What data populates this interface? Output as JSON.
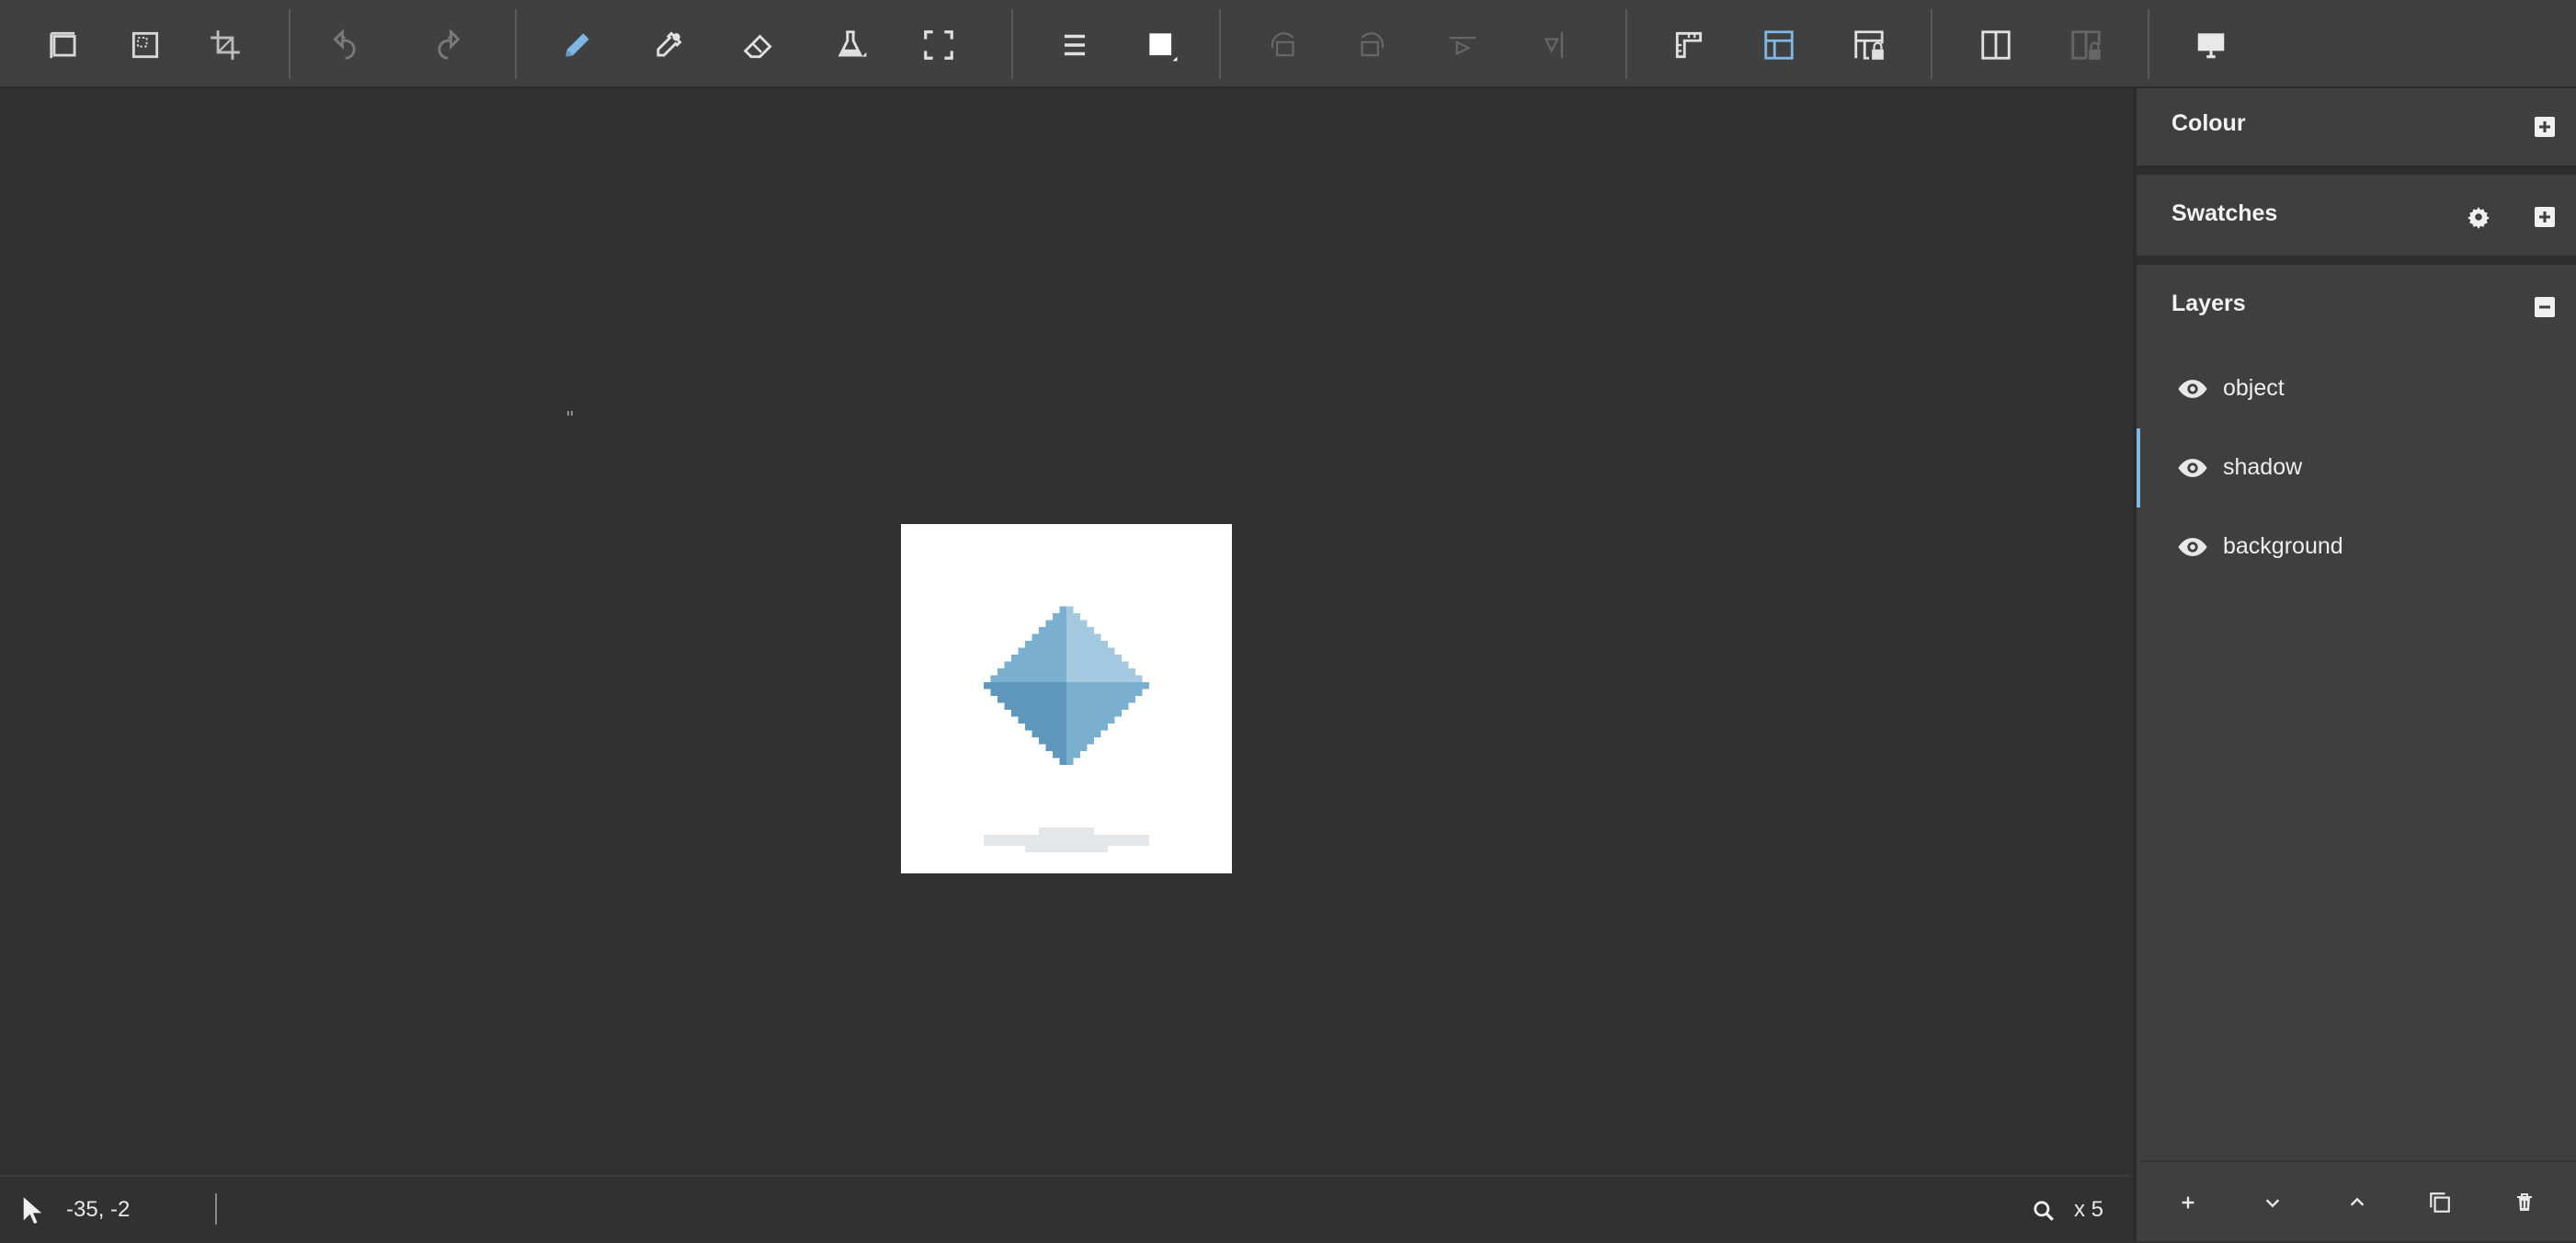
{
  "toolbar": {
    "tools": [
      {
        "name": "canvas-size-icon"
      },
      {
        "name": "marquee-select-icon"
      },
      {
        "name": "crop-icon"
      },
      {
        "name": "undo-icon"
      },
      {
        "name": "redo-icon"
      },
      {
        "name": "pencil-icon",
        "active": true
      },
      {
        "name": "eyedropper-icon"
      },
      {
        "name": "eraser-icon"
      },
      {
        "name": "fill-flask-icon"
      },
      {
        "name": "fullscreen-icon"
      },
      {
        "name": "menu-lines-icon"
      },
      {
        "name": "brush-size-icon"
      },
      {
        "name": "rotate-left-icon"
      },
      {
        "name": "rotate-right-icon"
      },
      {
        "name": "flip-horizontal-icon"
      },
      {
        "name": "flip-vertical-icon"
      },
      {
        "name": "ruler-icon"
      },
      {
        "name": "grid-icon",
        "active": true
      },
      {
        "name": "grid-lock-icon"
      },
      {
        "name": "split-view-icon"
      },
      {
        "name": "split-view-lock-icon"
      },
      {
        "name": "display-icon"
      }
    ]
  },
  "panels": {
    "colour": {
      "title": "Colour"
    },
    "swatches": {
      "title": "Swatches"
    },
    "layers": {
      "title": "Layers",
      "items": [
        {
          "label": "object",
          "visible": true
        },
        {
          "label": "shadow",
          "visible": true,
          "selected": true
        },
        {
          "label": "background",
          "visible": true
        }
      ]
    }
  },
  "status": {
    "coords": "-35, -2",
    "zoom": "x 5"
  },
  "colors": {
    "accent": "#7fb6e4",
    "gem_light": "#a3c8df",
    "gem_mid": "#7bafcf",
    "gem_dark": "#5f97bd",
    "shadow": "#e5e8eb"
  }
}
